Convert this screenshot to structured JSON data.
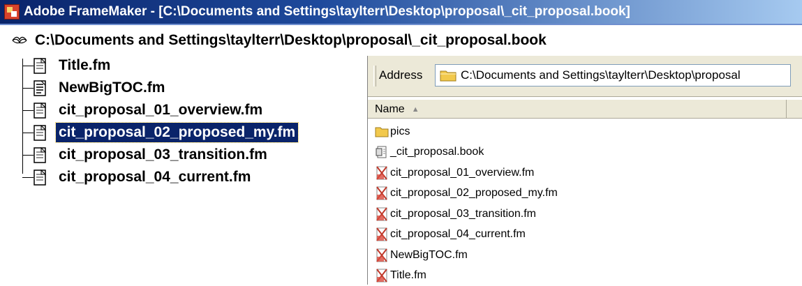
{
  "window": {
    "title": "Adobe FrameMaker - [C:\\Documents and Settings\\taylterr\\Desktop\\proposal\\_cit_proposal.book]"
  },
  "book": {
    "path": "C:\\Documents and Settings\\taylterr\\Desktop\\proposal\\_cit_proposal.book",
    "icon": "book-icon",
    "items": [
      {
        "label": "Title.fm",
        "icon": "document-icon"
      },
      {
        "label": "NewBigTOC.fm",
        "icon": "toc-document-icon"
      },
      {
        "label": "cit_proposal_01_overview.fm",
        "icon": "document-icon"
      },
      {
        "label": "cit_proposal_02_proposed_my.fm",
        "icon": "document-icon",
        "selected": true
      },
      {
        "label": "cit_proposal_03_transition.fm",
        "icon": "document-icon"
      },
      {
        "label": "cit_proposal_04_current.fm",
        "icon": "document-icon"
      }
    ]
  },
  "explorer": {
    "address_label": "Address",
    "address_value": "C:\\Documents and Settings\\taylterr\\Desktop\\proposal",
    "column_name": "Name",
    "sort_indicator": "▲",
    "files": [
      {
        "label": "pics",
        "icon": "folder-icon"
      },
      {
        "label": "_cit_proposal.book",
        "icon": "book-file-icon"
      },
      {
        "label": "cit_proposal_01_overview.fm",
        "icon": "framemaker-file-icon"
      },
      {
        "label": "cit_proposal_02_proposed_my.fm",
        "icon": "framemaker-file-icon"
      },
      {
        "label": "cit_proposal_03_transition.fm",
        "icon": "framemaker-file-icon"
      },
      {
        "label": "cit_proposal_04_current.fm",
        "icon": "framemaker-file-icon"
      },
      {
        "label": "NewBigTOC.fm",
        "icon": "framemaker-file-icon"
      },
      {
        "label": "Title.fm",
        "icon": "framemaker-file-icon"
      }
    ]
  },
  "colors": {
    "titlebar_start": "#0a246a",
    "titlebar_end": "#a6caf0",
    "selection": "#0a246a",
    "folder": "#f2c94c"
  }
}
